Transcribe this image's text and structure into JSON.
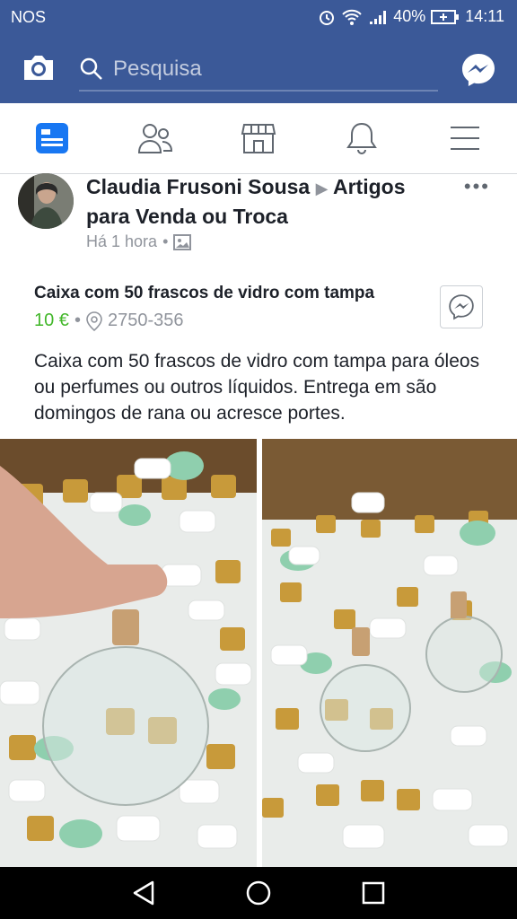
{
  "status": {
    "carrier": "NOS",
    "battery": "40%",
    "time": "14:11"
  },
  "appbar": {
    "search_placeholder": "Pesquisa"
  },
  "post": {
    "author": "Claudia Frusoni Sousa",
    "group": "Artigos para Venda ou Troca",
    "time": "Há 1 hora",
    "item_title": "Caixa com 50 frascos de vidro com tampa",
    "price": "10 €",
    "location": "2750-356",
    "description": "Caixa com 50 frascos de vidro com tampa para óleos ou perfumes ou outros líquidos.  Entrega em são domingos de rana ou acresce portes."
  },
  "colors": {
    "brand": "#3b5998",
    "price": "#42b72a",
    "muted": "#90949c"
  }
}
